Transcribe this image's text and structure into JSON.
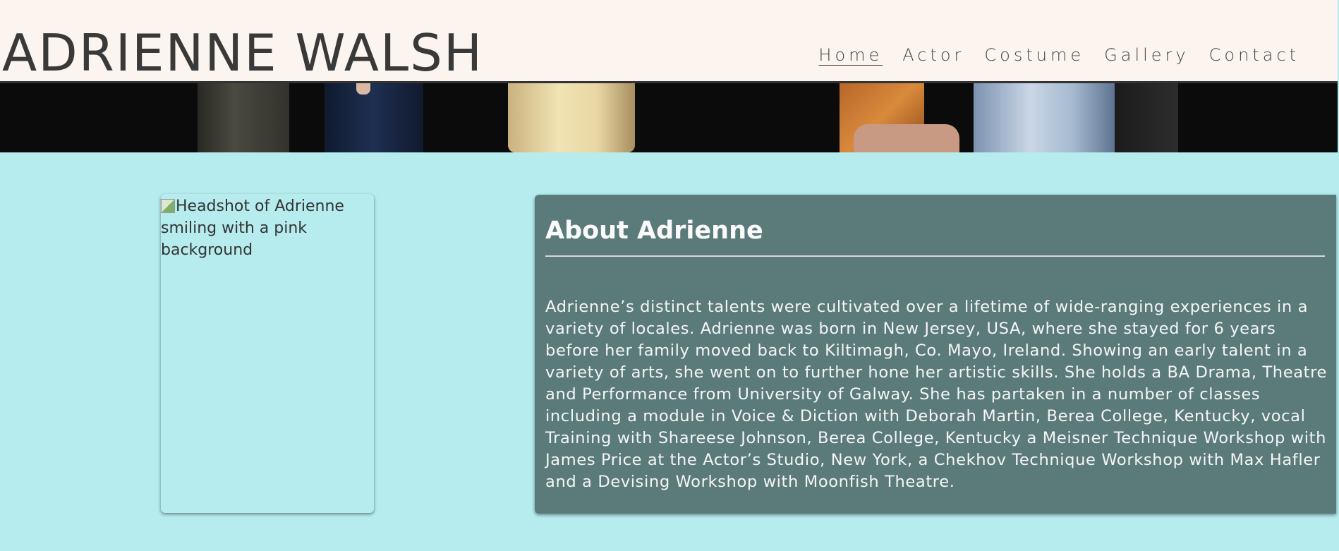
{
  "header": {
    "site_title": "ADRIENNE WALSH",
    "nav": [
      {
        "label": "Home",
        "active": true
      },
      {
        "label": "Actor",
        "active": false
      },
      {
        "label": "Costume",
        "active": false
      },
      {
        "label": "Gallery",
        "active": false
      },
      {
        "label": "Contact",
        "active": false
      }
    ]
  },
  "headshot": {
    "alt_text": "Headshot of Adrienne smiling with a pink background"
  },
  "about": {
    "title": "About Adrienne",
    "body": "Adrienne’s distinct talents were cultivated over a lifetime of wide-ranging experiences in a variety of locales. Adrienne was born in New Jersey, USA, where she stayed for 6 years before her family moved back to Kiltimagh, Co. Mayo, Ireland. Showing an early talent in a variety of arts, she went on to further hone her artistic skills. She holds a BA Drama, Theatre and Performance from University of Galway. She has partaken in a number of classes including a module in Voice & Diction with Deborah Martin, Berea College, Kentucky, vocal Training with Shareese Johnson, Berea College, Kentucky a Meisner Technique Workshop with James Price at the Actor’s Studio, New York, a Chekhov Technique Workshop with Max Hafler and a Devising Workshop with Moonfish Theatre."
  },
  "colors": {
    "header_bg": "#fcf4ef",
    "page_bg": "#b6ecee",
    "card_bg": "#5b7b7b"
  }
}
